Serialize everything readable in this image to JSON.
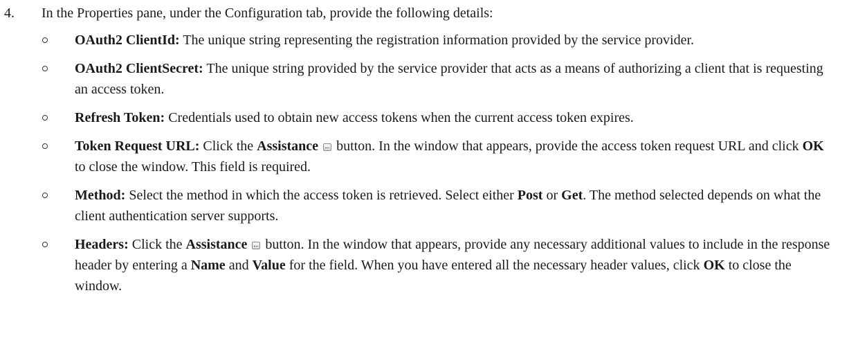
{
  "step": {
    "number": "4.",
    "intro": "In the Properties pane, under the Configuration tab, provide the following details:"
  },
  "items": [
    {
      "term": "OAuth2 ClientId:",
      "text": " The unique string representing the registration information provided by the service provider."
    },
    {
      "term": "OAuth2 ClientSecret:",
      "text": " The unique string provided by the service provider that acts as a means of authorizing a client that is requesting an access token."
    },
    {
      "term": "Refresh Token:",
      "text": " Credentials used to obtain new access tokens when the current access token expires."
    },
    {
      "term": "Token Request URL:",
      "t1": " Click the ",
      "assistance": "Assistance",
      "t2": " button. In the window that appears, provide the access token request URL and click ",
      "ok": "OK",
      "t3": " to close the window. This field is required."
    },
    {
      "term": "Method:",
      "t1": " Select the method in which the access token is retrieved. Select either ",
      "post": "Post",
      "t2": " or ",
      "get": "Get",
      "t3": ". The method selected depends on what the client authentication server supports."
    },
    {
      "term": "Headers:",
      "t1": " Click the ",
      "assistance": "Assistance",
      "t2": " button. In the window that appears, provide any necessary additional values to include in the response header by entering a ",
      "name": "Name",
      "t3": " and ",
      "value": "Value",
      "t4": " for the field. When you have entered all the necessary header values, click ",
      "ok": "OK",
      "t5": " to close the window."
    }
  ],
  "icons": {
    "bullet": "hollow-circle-bullet",
    "assistance": "ellipsis-button-icon"
  }
}
